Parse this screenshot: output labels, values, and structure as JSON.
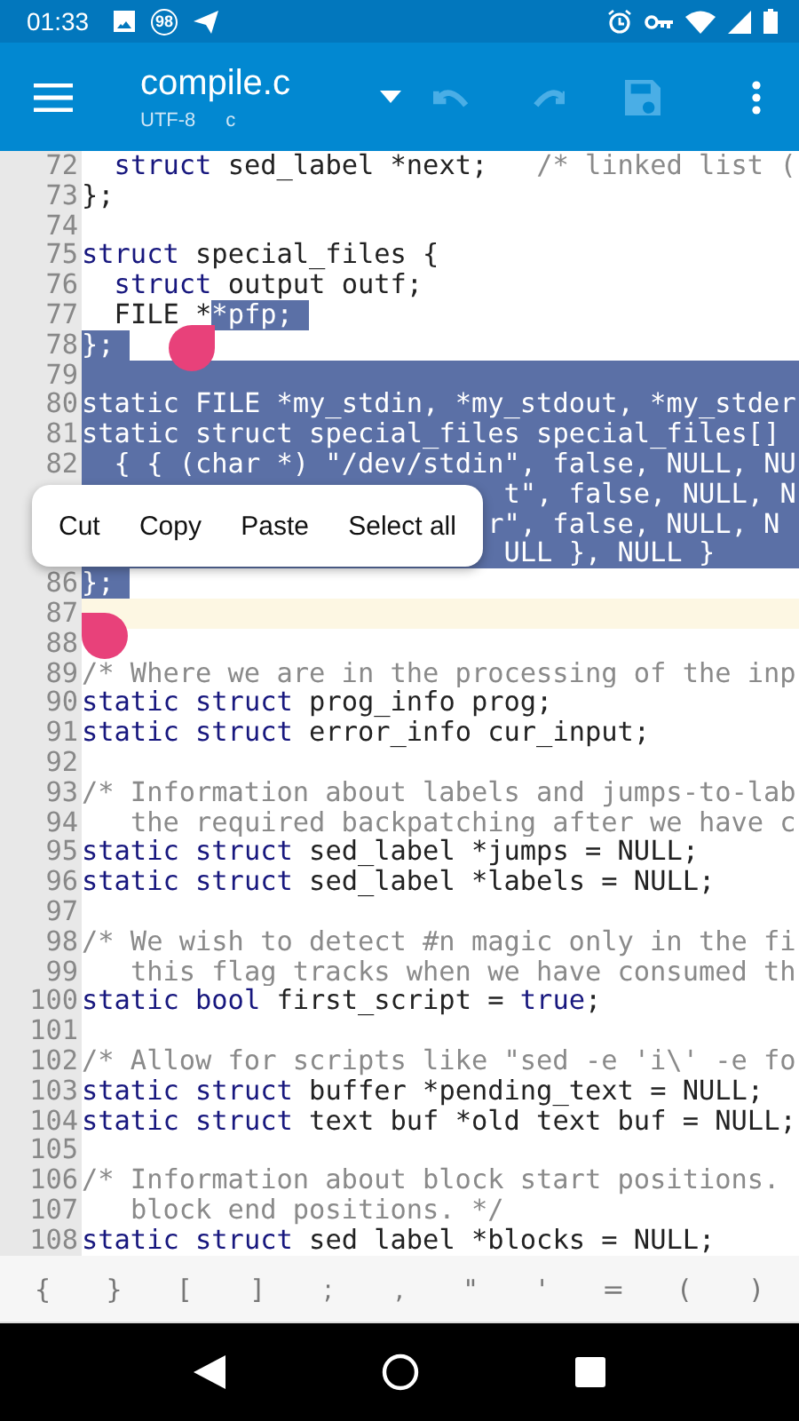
{
  "status_bar": {
    "time": "01:33",
    "badge": "98"
  },
  "toolbar": {
    "title": "compile.c",
    "encoding": "UTF-8",
    "language": "c",
    "actions": [
      {
        "kind": "undo",
        "disabled": true
      },
      {
        "kind": "redo",
        "disabled": true
      },
      {
        "kind": "save",
        "disabled": true
      }
    ]
  },
  "editor": {
    "lines": [
      {
        "number": "72",
        "current": false,
        "row_selected": false,
        "segments": [
          {
            "kind": "keyword",
            "text": "  struct"
          },
          {
            "kind": "plain",
            "text": " sed_label *next;   "
          },
          {
            "kind": "comment",
            "text": "/* linked list ("
          }
        ]
      },
      {
        "number": "73",
        "current": false,
        "row_selected": false,
        "segments": [
          {
            "kind": "plain",
            "text": "};"
          }
        ]
      },
      {
        "number": "74",
        "current": false,
        "row_selected": false
      },
      {
        "number": "75",
        "current": false,
        "row_selected": false,
        "segments": [
          {
            "kind": "keyword",
            "text": "struct"
          },
          {
            "kind": "plain",
            "text": " special_files {"
          }
        ]
      },
      {
        "number": "76",
        "current": false,
        "row_selected": false,
        "segments": [
          {
            "kind": "keyword",
            "text": "  struct"
          },
          {
            "kind": "plain",
            "text": " output outf;"
          }
        ]
      },
      {
        "number": "77",
        "current": false,
        "row_selected": false,
        "segments": [
          {
            "kind": "plain",
            "text": "  FILE *",
            "selected": false
          },
          {
            "kind": "plain",
            "text": "*pfp; ",
            "selected": true
          }
        ]
      },
      {
        "number": "78",
        "current": false,
        "row_selected": false,
        "segments": [
          {
            "kind": "plain",
            "text": "}; ",
            "selected": true
          }
        ]
      },
      {
        "number": "79",
        "current": false,
        "row_selected": true
      },
      {
        "number": "80",
        "current": false,
        "row_selected": true,
        "segments": [
          {
            "kind": "keyword",
            "text": "static"
          },
          {
            "kind": "plain",
            "text": " FILE *my_stdin, *my_stdout, *my_stder"
          }
        ]
      },
      {
        "number": "81",
        "current": false,
        "row_selected": true,
        "segments": [
          {
            "kind": "keyword",
            "text": "static "
          },
          {
            "kind": "keyword",
            "text": "struct"
          },
          {
            "kind": "plain",
            "text": " special_files special_files[]"
          }
        ]
      },
      {
        "number": "82",
        "current": false,
        "row_selected": true,
        "segments": [
          {
            "kind": "plain",
            "text": "  { { ("
          },
          {
            "kind": "keyword",
            "text": "char"
          },
          {
            "kind": "plain",
            "text": " *) \"/dev/stdin\", "
          },
          {
            "kind": "keyword",
            "text": "false"
          },
          {
            "kind": "plain",
            "text": ", NULL, NU"
          }
        ]
      },
      {
        "current": false,
        "row_selected": true,
        "segments": [
          {
            "kind": "plain",
            "text": "                          t\", "
          },
          {
            "kind": "keyword",
            "text": "false"
          },
          {
            "kind": "plain",
            "text": ", NULL, N"
          }
        ]
      },
      {
        "current": false,
        "row_selected": true,
        "segments": [
          {
            "kind": "plain",
            "text": "                         r\", "
          },
          {
            "kind": "keyword",
            "text": "false"
          },
          {
            "kind": "plain",
            "text": ", NULL, N"
          }
        ]
      },
      {
        "current": false,
        "row_selected": true,
        "segments": [
          {
            "kind": "plain",
            "text": "                          ULL }, NULL }"
          }
        ]
      },
      {
        "number": "86",
        "current": false,
        "row_selected": false,
        "segments": [
          {
            "kind": "plain",
            "text": "}; ",
            "selected": true
          }
        ]
      },
      {
        "number": "87",
        "current": true,
        "row_selected": false
      },
      {
        "number": "88",
        "current": false,
        "row_selected": false
      },
      {
        "number": "89",
        "current": false,
        "row_selected": false,
        "segments": [
          {
            "kind": "comment",
            "text": "/* Where we are in the processing of the inp"
          }
        ]
      },
      {
        "number": "90",
        "current": false,
        "row_selected": false,
        "segments": [
          {
            "kind": "keyword",
            "text": "static "
          },
          {
            "kind": "keyword",
            "text": "struct"
          },
          {
            "kind": "plain",
            "text": " prog_info prog;"
          }
        ]
      },
      {
        "number": "91",
        "current": false,
        "row_selected": false,
        "segments": [
          {
            "kind": "keyword",
            "text": "static "
          },
          {
            "kind": "keyword",
            "text": "struct"
          },
          {
            "kind": "plain",
            "text": " error_info cur_input;"
          }
        ]
      },
      {
        "number": "92",
        "current": false,
        "row_selected": false
      },
      {
        "number": "93",
        "current": false,
        "row_selected": false,
        "segments": [
          {
            "kind": "comment",
            "text": "/* Information about labels and jumps-to-lab"
          }
        ]
      },
      {
        "number": "94",
        "current": false,
        "row_selected": false,
        "segments": [
          {
            "kind": "comment",
            "text": "   the required backpatching after we have c"
          }
        ]
      },
      {
        "number": "95",
        "current": false,
        "row_selected": false,
        "segments": [
          {
            "kind": "keyword",
            "text": "static "
          },
          {
            "kind": "keyword",
            "text": "struct"
          },
          {
            "kind": "plain",
            "text": " sed_label *jumps = NULL;"
          }
        ]
      },
      {
        "number": "96",
        "current": false,
        "row_selected": false,
        "segments": [
          {
            "kind": "keyword",
            "text": "static "
          },
          {
            "kind": "keyword",
            "text": "struct"
          },
          {
            "kind": "plain",
            "text": " sed_label *labels = NULL;"
          }
        ]
      },
      {
        "number": "97",
        "current": false,
        "row_selected": false
      },
      {
        "number": "98",
        "current": false,
        "row_selected": false,
        "segments": [
          {
            "kind": "comment",
            "text": "/* We wish to detect #n magic only in the fi"
          }
        ]
      },
      {
        "number": "99",
        "current": false,
        "row_selected": false,
        "segments": [
          {
            "kind": "comment",
            "text": "   this flag tracks when we have consumed th"
          }
        ]
      },
      {
        "number": "100",
        "current": false,
        "row_selected": false,
        "segments": [
          {
            "kind": "keyword",
            "text": "static "
          },
          {
            "kind": "keyword",
            "text": "bool"
          },
          {
            "kind": "plain",
            "text": " first_script = "
          },
          {
            "kind": "keyword",
            "text": "true"
          },
          {
            "kind": "plain",
            "text": ";"
          }
        ]
      },
      {
        "number": "101",
        "current": false,
        "row_selected": false
      },
      {
        "number": "102",
        "current": false,
        "row_selected": false,
        "segments": [
          {
            "kind": "comment",
            "text": "/* Allow for scripts like \"sed -e 'i\\' -e fo"
          }
        ]
      },
      {
        "number": "103",
        "current": false,
        "row_selected": false,
        "segments": [
          {
            "kind": "keyword",
            "text": "static "
          },
          {
            "kind": "keyword",
            "text": "struct"
          },
          {
            "kind": "plain",
            "text": " buffer *pending_text = NULL;"
          }
        ]
      },
      {
        "number": "104",
        "current": false,
        "row_selected": false,
        "segments": [
          {
            "kind": "keyword",
            "text": "static "
          },
          {
            "kind": "keyword",
            "text": "struct"
          },
          {
            "kind": "plain",
            "text": " text_buf *old_text_buf = NULL;"
          }
        ]
      },
      {
        "number": "105",
        "current": false,
        "row_selected": false
      },
      {
        "number": "106",
        "current": false,
        "row_selected": false,
        "segments": [
          {
            "kind": "comment",
            "text": "/* Information about block start positions."
          }
        ]
      },
      {
        "number": "107",
        "current": false,
        "row_selected": false,
        "segments": [
          {
            "kind": "comment",
            "text": "   block end positions. */"
          }
        ]
      },
      {
        "number": "108",
        "current": false,
        "row_selected": false,
        "segments": [
          {
            "kind": "keyword",
            "text": "static "
          },
          {
            "kind": "keyword",
            "text": "struct"
          },
          {
            "kind": "plain",
            "text": " sed_label *blocks = NULL;"
          }
        ]
      }
    ],
    "context_menu": [
      "Cut",
      "Copy",
      "Paste",
      "Select all"
    ]
  },
  "symbol_bar": [
    "{",
    "}",
    "[",
    "]",
    ";",
    ",",
    "\"",
    "'",
    "=",
    "(",
    ")"
  ]
}
